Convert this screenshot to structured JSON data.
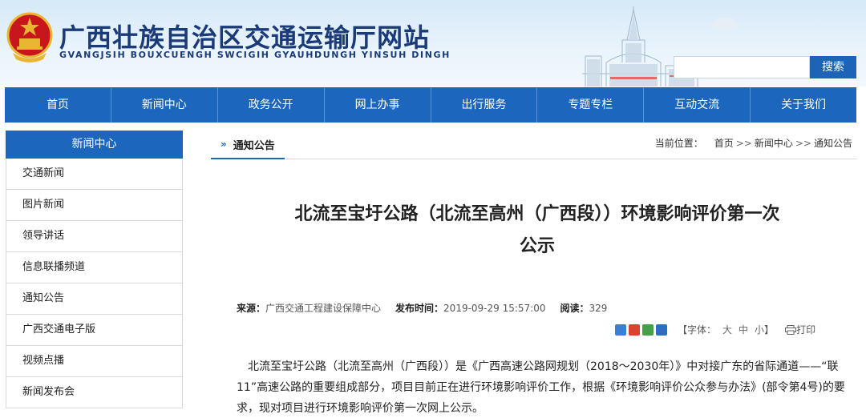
{
  "header": {
    "title": "广西壮族自治区交通运输厅网站",
    "subtitle": "GVANGJSIH BOUXCUENGH SWCIGIH GYAUHDUNGH YINSUH DINGH",
    "search_button": "搜索",
    "search_value": ""
  },
  "nav": [
    "首页",
    "新闻中心",
    "政务公开",
    "网上办事",
    "出行服务",
    "专题专栏",
    "互动交流",
    "关于我们"
  ],
  "sidebar": {
    "heading": "新闻中心",
    "items": [
      "交通新闻",
      "图片新闻",
      "领导讲话",
      "信息联播频道",
      "通知公告",
      "广西交通电子版",
      "视频点播",
      "新闻发布会"
    ]
  },
  "tab": {
    "label": "通知公告"
  },
  "breadcrumb": {
    "label": "当前位置：",
    "items": [
      "首页",
      "新闻中心",
      "通知公告"
    ],
    "separator": ">>"
  },
  "article": {
    "title_line1": "北流至宝圩公路（北流至高州（广西段））环境影响评价第一次",
    "title_line2": "公示",
    "source_label": "来源：",
    "source": "广西交通工程建设保障中心",
    "published_label": "发布时间：",
    "published": "2019-09-29 15:57:00",
    "reads_label": "阅读：",
    "reads": "329",
    "font_label": "【字体：",
    "font_sizes": [
      "大",
      "中",
      "小"
    ],
    "font_close": "】",
    "print_label": "打印",
    "paragraph": "北流至宝圩公路（北流至高州（广西段））是《广西高速公路网规划（2018～2030年）》中对接广东的省际通道——“联11”高速公路的重要组成部分，项目目前正在进行环境影响评价工作，根据《环境影响评价公众参与办法》(部令第4号)的要求，现对项目进行环境影响评价第一次网上公示。"
  },
  "colors": {
    "primary": "#1d66bd",
    "title": "#1b3a78",
    "emblem_red": "#c8161d",
    "emblem_gold": "#e9b634"
  }
}
